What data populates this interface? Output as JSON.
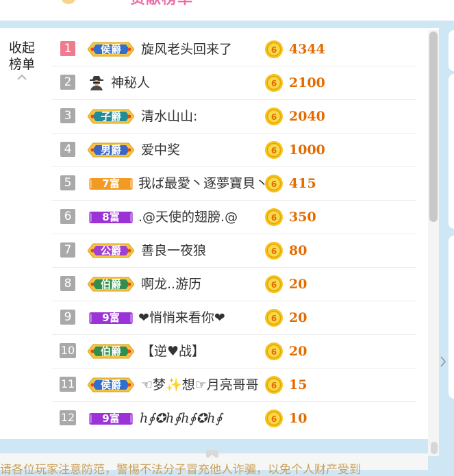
{
  "header": {
    "title_fragment": "贡献榜单"
  },
  "collapse": {
    "label": "收起\n榜单"
  },
  "ranking": [
    {
      "rank": "1",
      "badge": {
        "kind": "title",
        "text": "侯爵",
        "color": "#2f6fd1"
      },
      "avatar": null,
      "name": "旋风老头回来了",
      "amount": "4344"
    },
    {
      "rank": "2",
      "badge": null,
      "avatar": "spy-icon",
      "name": "神秘人",
      "amount": "2100"
    },
    {
      "rank": "3",
      "badge": {
        "kind": "title",
        "text": "子爵",
        "color": "#1f8d99"
      },
      "avatar": null,
      "name": "清水山山:",
      "amount": "2040"
    },
    {
      "rank": "4",
      "badge": {
        "kind": "title",
        "text": "男爵",
        "color": "#3a67c9"
      },
      "avatar": null,
      "name": "爱中奖",
      "amount": "1000"
    },
    {
      "rank": "5",
      "badge": {
        "kind": "rich",
        "text": "7富",
        "color": "#f39a25"
      },
      "avatar": null,
      "name": "我ば最愛丶逐夢寶貝丶",
      "amount": "415"
    },
    {
      "rank": "6",
      "badge": {
        "kind": "rich",
        "text": "8富",
        "color": "#9b33d6"
      },
      "avatar": null,
      "name": ".@天使的翅膀.@",
      "amount": "350"
    },
    {
      "rank": "7",
      "badge": {
        "kind": "title",
        "text": "公爵",
        "color": "#a140d0"
      },
      "avatar": null,
      "name": "善良一夜狼",
      "amount": "80"
    },
    {
      "rank": "8",
      "badge": {
        "kind": "title",
        "text": "伯爵",
        "color": "#2f8f4f"
      },
      "avatar": null,
      "name": "啊龙..游历",
      "amount": "20"
    },
    {
      "rank": "9",
      "badge": {
        "kind": "rich",
        "text": "9富",
        "color": "#9b33d6"
      },
      "avatar": null,
      "name": "❤悄悄来看你❤",
      "amount": "20"
    },
    {
      "rank": "10",
      "badge": {
        "kind": "title",
        "text": "伯爵",
        "color": "#2f8f4f"
      },
      "avatar": null,
      "name": "【逆♥战】",
      "amount": "20"
    },
    {
      "rank": "11",
      "badge": {
        "kind": "title",
        "text": "侯爵",
        "color": "#2f6fd1"
      },
      "avatar": null,
      "name": "☜梦✨想☞月亮哥哥",
      "amount": "15"
    },
    {
      "rank": "12",
      "badge": {
        "kind": "rich",
        "text": "9富",
        "color": "#9b33d6"
      },
      "avatar": null,
      "name": "ℎ∮✪ℎ∮ℎ∮✪ℎ∮",
      "amount": "10"
    }
  ],
  "coin_icon": "coin-icon",
  "colors": {
    "rank_top": "#f07b8f",
    "rank_default": "#a9a9a9",
    "amount": "#e46b00",
    "notice": "#c9a05a"
  },
  "footer": {
    "notice": "请各位玩家注意防范，警惕不法分子冒充他人诈骗，以免个人财产受到"
  }
}
